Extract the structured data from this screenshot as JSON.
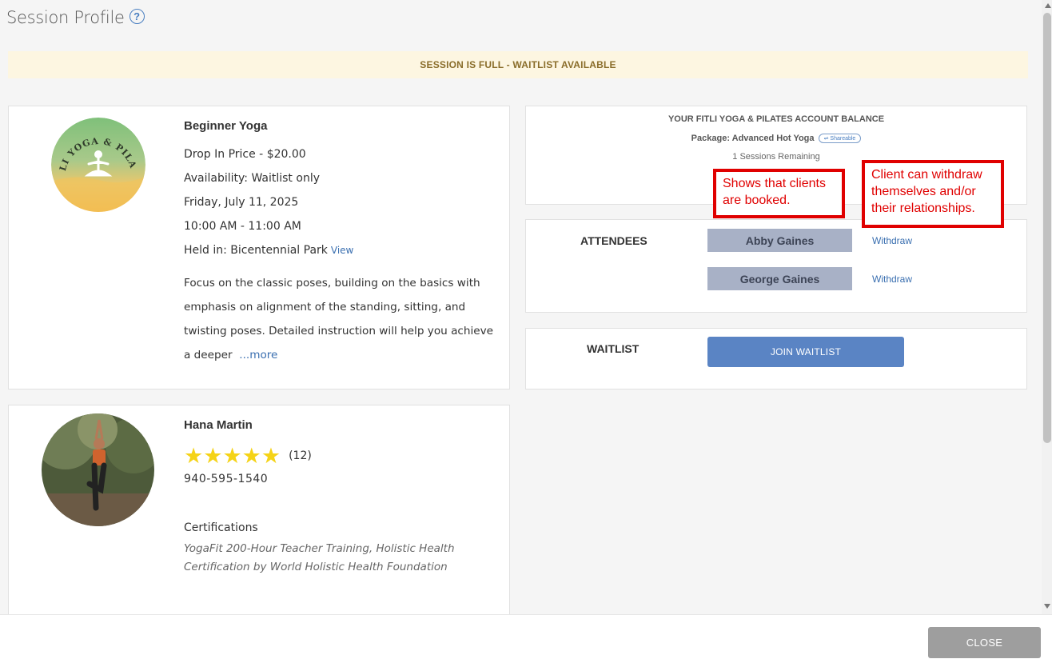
{
  "header": {
    "title": "Session Profile",
    "help_icon": "?"
  },
  "banner": {
    "text": "SESSION IS FULL - WAITLIST AVAILABLE",
    "bg_color": "#fdf6e1",
    "text_color": "#8a6d2a"
  },
  "session": {
    "logo_icon": "yoga-studio-logo-icon",
    "logo_text": "FITLI YOGA & PILATES",
    "name": "Beginner Yoga",
    "price": "Drop In Price - $20.00",
    "availability": "Availability: Waitlist only",
    "date": "Friday, July 11, 2025",
    "time": "10:00 AM - 11:00 AM",
    "location": "Held in: Bicentennial Park",
    "view_link": "View",
    "description": "Focus on the classic poses, building on the basics with emphasis on alignment of the standing, sitting, and twisting poses. Detailed instruction will help you achieve a deeper",
    "more_link": "...more"
  },
  "balance": {
    "title": "YOUR FITLI YOGA & PILATES ACCOUNT BALANCE",
    "package": "Package: Advanced Hot Yoga",
    "shareable": "Shareable",
    "remaining": "1 Sessions Remaining"
  },
  "attendees": {
    "label": "ATTENDEES",
    "items": [
      {
        "name": "Abby Gaines",
        "action": "Withdraw"
      },
      {
        "name": "George Gaines",
        "action": "Withdraw"
      }
    ]
  },
  "waitlist": {
    "label": "WAITLIST",
    "button": "JOIN WAITLIST",
    "button_color": "#5a84c4"
  },
  "instructor": {
    "avatar_icon": "instructor-photo",
    "name": "Hana Martin",
    "rating": 5,
    "review_count": "(12)",
    "phone": "940-595-1540",
    "cert_label": "Certifications",
    "certifications": "YogaFit 200-Hour Teacher Training, Holistic Health Certification by World Holistic Health Foundation"
  },
  "callouts": {
    "booked": "Shows that clients are booked.",
    "withdraw": "Client can withdraw themselves and/or their relationships.",
    "color": "#e00000"
  },
  "footer": {
    "close_button": "CLOSE"
  }
}
